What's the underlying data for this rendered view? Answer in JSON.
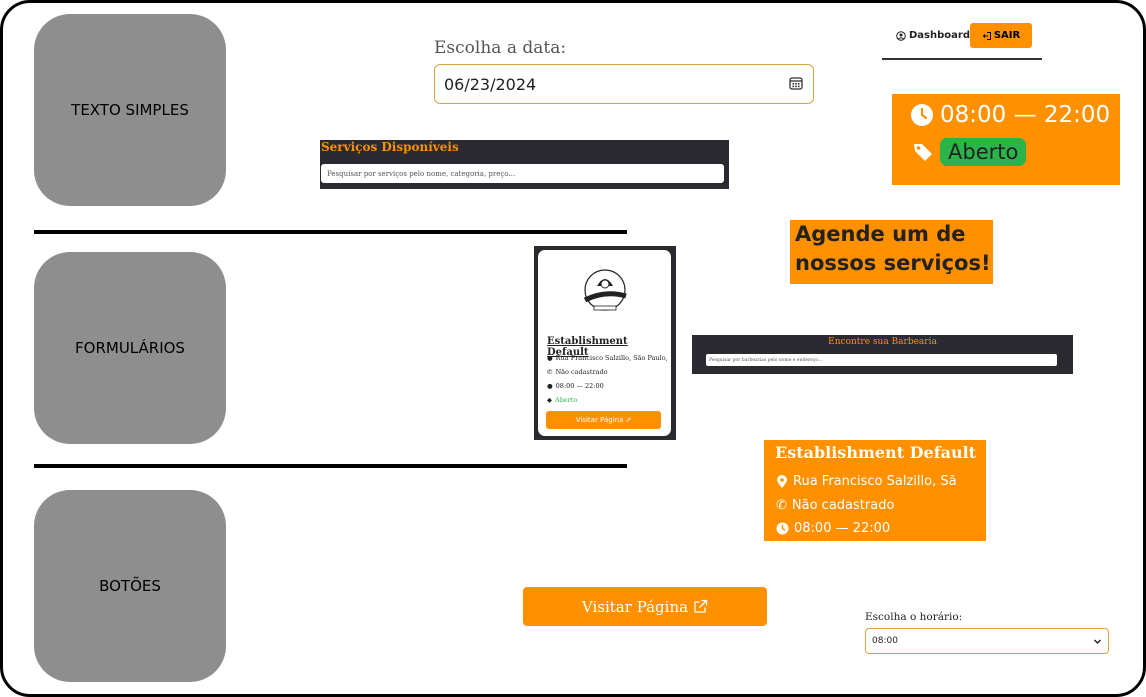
{
  "sections": [
    "TEXTO SIMPLES",
    "FORMULÁRIOS",
    "BOTÕES"
  ],
  "date_picker": {
    "label": "Escolha a data:",
    "value": "06/23/2024",
    "icon": "calendar-icon"
  },
  "nav": {
    "dashboard_label": "Dashboard",
    "sair_label": "SAIR"
  },
  "hours_card": {
    "hours": "08:00 — 22:00",
    "status": "Aberto"
  },
  "servicos": {
    "title": "Serviços Disponíveis",
    "placeholder": "Pesquisar por serviços pelo nome, categoria, preço..."
  },
  "agende": {
    "line1": "Agende um de",
    "line2": "nossos serviços!"
  },
  "shop_card": {
    "name": "Establishment Default",
    "address": "Rua Francisco Salzillo, São Paulo,",
    "phone": "Não cadastrado",
    "hours": "08:00 — 22:00",
    "status": "Aberto",
    "button": "Visitar Página"
  },
  "barbearia": {
    "title": "Encontre sua Barbearia",
    "placeholder": "Pesquisar por barbearias pelo nome e endereço..."
  },
  "establishment": {
    "name": "Establishment Default",
    "address": "Rua Francisco Salzillo, Sã",
    "phone": "Não cadastrado",
    "hours": "08:00 — 22:00"
  },
  "visit_button": {
    "label": "Visitar Página"
  },
  "hora": {
    "label": "Escolha o horário:",
    "value": "08:00"
  },
  "colors": {
    "accent": "#ff9100",
    "dark": "#2b2a31",
    "green": "#2bb44a",
    "box_gray": "#8e8e8e"
  }
}
